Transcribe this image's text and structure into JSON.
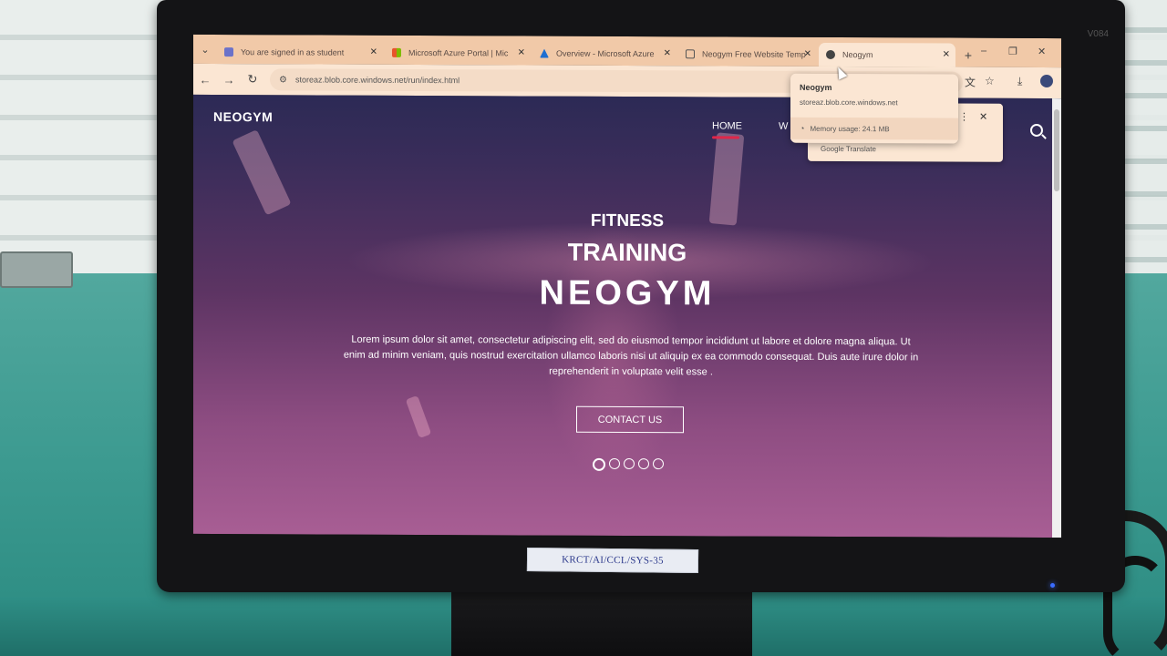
{
  "monitor": {
    "brand": "V084",
    "asset_label": "KRCT/AI/CCL/SYS-35"
  },
  "browser": {
    "tabs": [
      {
        "title": "You are signed in as student",
        "favicon": "s-icon",
        "color": "#6b72c9"
      },
      {
        "title": "Microsoft Azure Portal | Mic",
        "favicon": "ms-icon",
        "color": "#c2552c"
      },
      {
        "title": "Overview - Microsoft Azure",
        "favicon": "azure-icon",
        "color": "#1f6fd1"
      },
      {
        "title": "Neogym Free Website Temp",
        "favicon": "window-icon",
        "color": "#555555"
      },
      {
        "title": "Neogym",
        "favicon": "globe-icon",
        "color": "#333333"
      }
    ],
    "active_tab_index": 4,
    "url": "storeaz.blob.core.windows.net/run/index.html",
    "hover_card": {
      "title": "Neogym",
      "url": "storeaz.blob.core.windows.net",
      "memory": "Memory usage: 24.1 MB"
    },
    "translate_popup": {
      "label": "Google Translate"
    }
  },
  "site": {
    "logo": "NEOGYM",
    "nav": {
      "home": "HOME",
      "partial": "W"
    },
    "hero": {
      "line1": "FITNESS",
      "line2": "TRAINING",
      "line3": "NEOGYM",
      "paragraph": "Lorem ipsum dolor sit amet, consectetur adipiscing elit, sed do eiusmod tempor incididunt ut labore et dolore magna aliqua. Ut enim ad minim veniam, quis nostrud exercitation ullamco laboris nisi ut aliquip ex ea commodo consequat. Duis aute irure dolor in reprehenderit in voluptate velit esse .",
      "button": "CONTACT US"
    },
    "slider": {
      "count": 5,
      "active": 1
    }
  }
}
